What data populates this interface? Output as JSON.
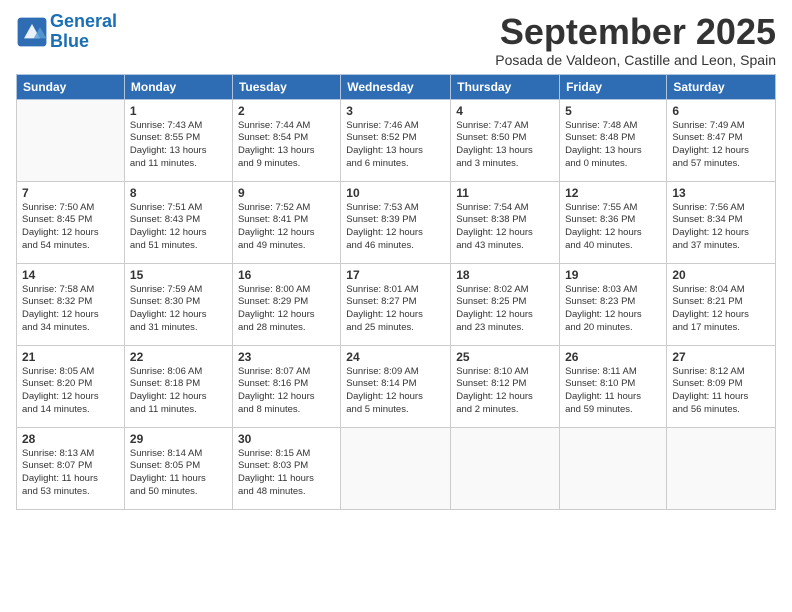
{
  "logo": {
    "line1": "General",
    "line2": "Blue"
  },
  "title": "September 2025",
  "subtitle": "Posada de Valdeon, Castille and Leon, Spain",
  "days_of_week": [
    "Sunday",
    "Monday",
    "Tuesday",
    "Wednesday",
    "Thursday",
    "Friday",
    "Saturday"
  ],
  "weeks": [
    [
      {
        "day": "",
        "info": ""
      },
      {
        "day": "1",
        "info": "Sunrise: 7:43 AM\nSunset: 8:55 PM\nDaylight: 13 hours\nand 11 minutes."
      },
      {
        "day": "2",
        "info": "Sunrise: 7:44 AM\nSunset: 8:54 PM\nDaylight: 13 hours\nand 9 minutes."
      },
      {
        "day": "3",
        "info": "Sunrise: 7:46 AM\nSunset: 8:52 PM\nDaylight: 13 hours\nand 6 minutes."
      },
      {
        "day": "4",
        "info": "Sunrise: 7:47 AM\nSunset: 8:50 PM\nDaylight: 13 hours\nand 3 minutes."
      },
      {
        "day": "5",
        "info": "Sunrise: 7:48 AM\nSunset: 8:48 PM\nDaylight: 13 hours\nand 0 minutes."
      },
      {
        "day": "6",
        "info": "Sunrise: 7:49 AM\nSunset: 8:47 PM\nDaylight: 12 hours\nand 57 minutes."
      }
    ],
    [
      {
        "day": "7",
        "info": "Sunrise: 7:50 AM\nSunset: 8:45 PM\nDaylight: 12 hours\nand 54 minutes."
      },
      {
        "day": "8",
        "info": "Sunrise: 7:51 AM\nSunset: 8:43 PM\nDaylight: 12 hours\nand 51 minutes."
      },
      {
        "day": "9",
        "info": "Sunrise: 7:52 AM\nSunset: 8:41 PM\nDaylight: 12 hours\nand 49 minutes."
      },
      {
        "day": "10",
        "info": "Sunrise: 7:53 AM\nSunset: 8:39 PM\nDaylight: 12 hours\nand 46 minutes."
      },
      {
        "day": "11",
        "info": "Sunrise: 7:54 AM\nSunset: 8:38 PM\nDaylight: 12 hours\nand 43 minutes."
      },
      {
        "day": "12",
        "info": "Sunrise: 7:55 AM\nSunset: 8:36 PM\nDaylight: 12 hours\nand 40 minutes."
      },
      {
        "day": "13",
        "info": "Sunrise: 7:56 AM\nSunset: 8:34 PM\nDaylight: 12 hours\nand 37 minutes."
      }
    ],
    [
      {
        "day": "14",
        "info": "Sunrise: 7:58 AM\nSunset: 8:32 PM\nDaylight: 12 hours\nand 34 minutes."
      },
      {
        "day": "15",
        "info": "Sunrise: 7:59 AM\nSunset: 8:30 PM\nDaylight: 12 hours\nand 31 minutes."
      },
      {
        "day": "16",
        "info": "Sunrise: 8:00 AM\nSunset: 8:29 PM\nDaylight: 12 hours\nand 28 minutes."
      },
      {
        "day": "17",
        "info": "Sunrise: 8:01 AM\nSunset: 8:27 PM\nDaylight: 12 hours\nand 25 minutes."
      },
      {
        "day": "18",
        "info": "Sunrise: 8:02 AM\nSunset: 8:25 PM\nDaylight: 12 hours\nand 23 minutes."
      },
      {
        "day": "19",
        "info": "Sunrise: 8:03 AM\nSunset: 8:23 PM\nDaylight: 12 hours\nand 20 minutes."
      },
      {
        "day": "20",
        "info": "Sunrise: 8:04 AM\nSunset: 8:21 PM\nDaylight: 12 hours\nand 17 minutes."
      }
    ],
    [
      {
        "day": "21",
        "info": "Sunrise: 8:05 AM\nSunset: 8:20 PM\nDaylight: 12 hours\nand 14 minutes."
      },
      {
        "day": "22",
        "info": "Sunrise: 8:06 AM\nSunset: 8:18 PM\nDaylight: 12 hours\nand 11 minutes."
      },
      {
        "day": "23",
        "info": "Sunrise: 8:07 AM\nSunset: 8:16 PM\nDaylight: 12 hours\nand 8 minutes."
      },
      {
        "day": "24",
        "info": "Sunrise: 8:09 AM\nSunset: 8:14 PM\nDaylight: 12 hours\nand 5 minutes."
      },
      {
        "day": "25",
        "info": "Sunrise: 8:10 AM\nSunset: 8:12 PM\nDaylight: 12 hours\nand 2 minutes."
      },
      {
        "day": "26",
        "info": "Sunrise: 8:11 AM\nSunset: 8:10 PM\nDaylight: 11 hours\nand 59 minutes."
      },
      {
        "day": "27",
        "info": "Sunrise: 8:12 AM\nSunset: 8:09 PM\nDaylight: 11 hours\nand 56 minutes."
      }
    ],
    [
      {
        "day": "28",
        "info": "Sunrise: 8:13 AM\nSunset: 8:07 PM\nDaylight: 11 hours\nand 53 minutes."
      },
      {
        "day": "29",
        "info": "Sunrise: 8:14 AM\nSunset: 8:05 PM\nDaylight: 11 hours\nand 50 minutes."
      },
      {
        "day": "30",
        "info": "Sunrise: 8:15 AM\nSunset: 8:03 PM\nDaylight: 11 hours\nand 48 minutes."
      },
      {
        "day": "",
        "info": ""
      },
      {
        "day": "",
        "info": ""
      },
      {
        "day": "",
        "info": ""
      },
      {
        "day": "",
        "info": ""
      }
    ]
  ]
}
